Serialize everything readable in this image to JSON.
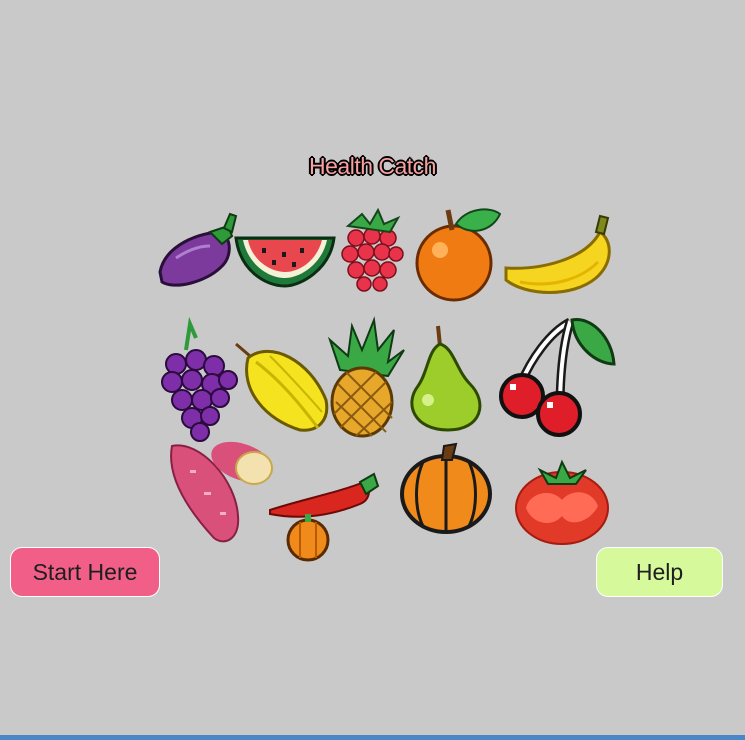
{
  "title": "Health Catch",
  "buttons": {
    "start_label": "Start Here",
    "help_label": "Help"
  },
  "fruits": [
    {
      "row": 1,
      "icon": "eggplant-icon"
    },
    {
      "row": 1,
      "icon": "watermelon-icon"
    },
    {
      "row": 1,
      "icon": "raspberry-icon"
    },
    {
      "row": 1,
      "icon": "orange-icon"
    },
    {
      "row": 1,
      "icon": "banana-icon"
    },
    {
      "row": 2,
      "icon": "grapes-icon"
    },
    {
      "row": 2,
      "icon": "starfruit-icon"
    },
    {
      "row": 2,
      "icon": "pineapple-icon"
    },
    {
      "row": 2,
      "icon": "pear-icon"
    },
    {
      "row": 2,
      "icon": "cherries-icon"
    },
    {
      "row": 3,
      "icon": "sweet-potato-icon"
    },
    {
      "row": 3,
      "icon": "chili-pepper-icon"
    },
    {
      "row": 3,
      "icon": "pumpkin-icon"
    },
    {
      "row": 3,
      "icon": "tomato-icon"
    }
  ],
  "colors": {
    "background": "#c9c9c9",
    "start_button": "#f15f89",
    "help_button": "#d6f99c",
    "title_fill": "#f7a1a1",
    "bottom_bar": "#4b86c6"
  }
}
